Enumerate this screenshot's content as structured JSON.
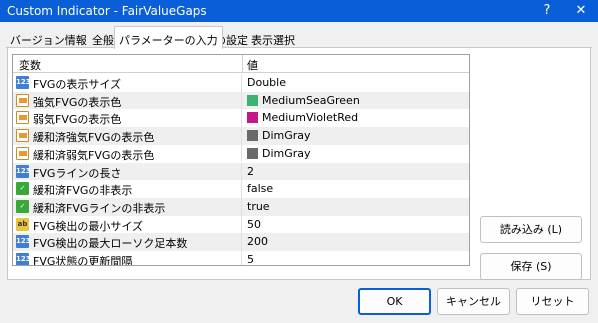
{
  "window": {
    "title": "Custom Indicator - FairValueGaps",
    "help_label": "?",
    "close_label": "✕"
  },
  "tabs": [
    {
      "label": "バージョン情報"
    },
    {
      "label": "全般"
    },
    {
      "label": "パラメーターの入力"
    },
    {
      "label": "色の設定"
    },
    {
      "label": "表示選択"
    }
  ],
  "grid": {
    "header_variable": "変数",
    "header_value": "値",
    "rows": [
      {
        "icon": "num",
        "icon_text": "123",
        "label": "FVGの表示サイズ",
        "value": "Double"
      },
      {
        "icon": "color",
        "label": "強気FVGの表示色",
        "value": "MediumSeaGreen",
        "swatch": "#3cb371"
      },
      {
        "icon": "color",
        "label": "弱気FVGの表示色",
        "value": "MediumVioletRed",
        "swatch": "#c71585"
      },
      {
        "icon": "color",
        "label": "緩和済強気FVGの表示色",
        "value": "DimGray",
        "swatch": "#696969"
      },
      {
        "icon": "color",
        "label": "緩和済弱気FVGの表示色",
        "value": "DimGray",
        "swatch": "#696969"
      },
      {
        "icon": "num",
        "icon_text": "123",
        "label": "FVGラインの長さ",
        "value": "2"
      },
      {
        "icon": "bool",
        "icon_text": "✓",
        "label": "緩和済FVGの非表示",
        "value": "false"
      },
      {
        "icon": "bool",
        "icon_text": "✓",
        "label": "緩和済FVGラインの非表示",
        "value": "true"
      },
      {
        "icon": "str",
        "icon_text": "ab",
        "label": "FVG検出の最小サイズ",
        "value": "50"
      },
      {
        "icon": "num",
        "icon_text": "123",
        "label": "FVG検出の最大ローソク足本数",
        "value": "200"
      },
      {
        "icon": "num",
        "icon_text": "123",
        "label": "FVG状態の更新間隔",
        "value": "5"
      }
    ]
  },
  "buttons": {
    "load": "読み込み (L)",
    "save": "保存 (S)",
    "ok": "OK",
    "cancel": "キャンセル",
    "reset": "リセット"
  },
  "colors": {
    "titlebar": "#0a5fd8",
    "accent": "#0a5fd8"
  }
}
